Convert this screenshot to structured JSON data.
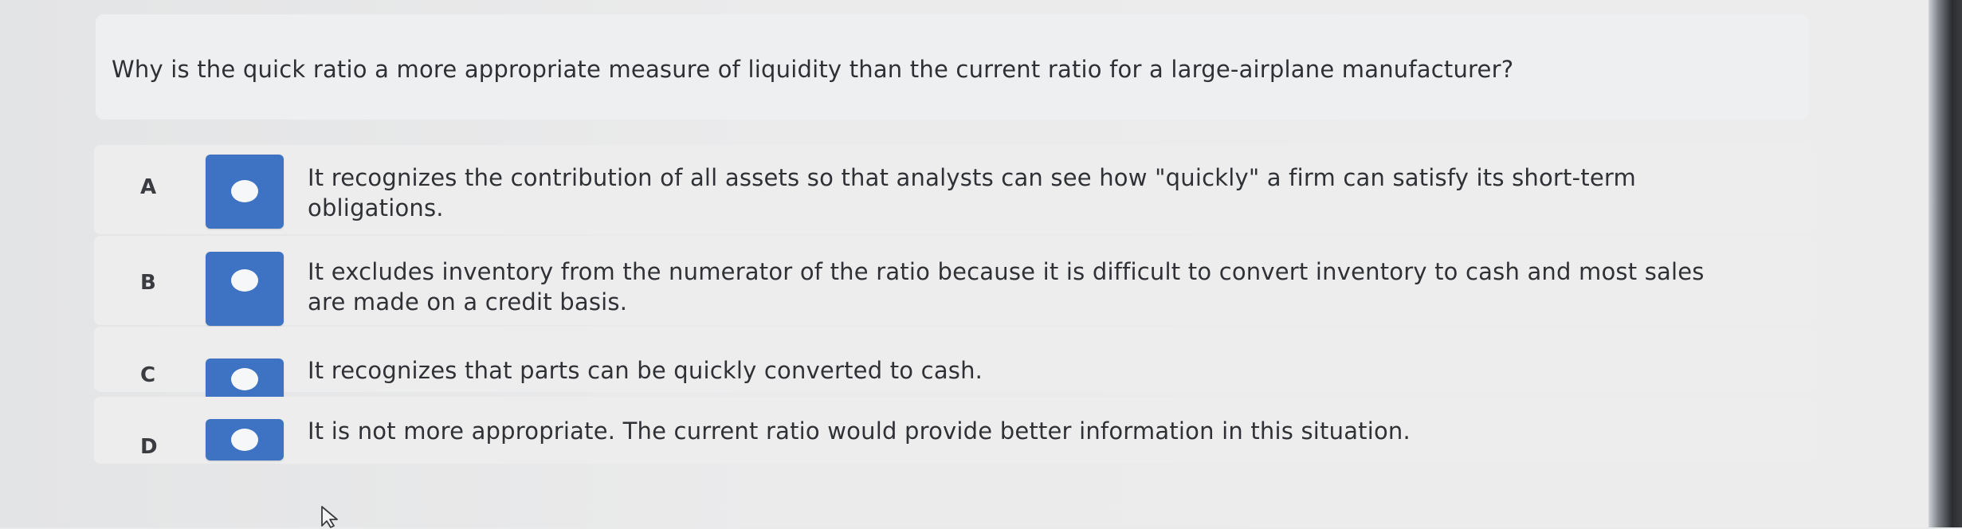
{
  "question": {
    "text": "Why is the quick ratio a more appropriate measure of liquidity than the current ratio for a large-airplane manufacturer?"
  },
  "options": [
    {
      "letter": "A",
      "line1": "It recognizes the contribution of all assets so that analysts can see how \"quickly\" a firm can satisfy its short-term",
      "line2": "obligations."
    },
    {
      "letter": "B",
      "line1": "It excludes inventory from the numerator of the ratio because it is difficult to convert inventory to cash and most sales",
      "line2": "are made on a credit basis."
    },
    {
      "letter": "C",
      "line1": "It recognizes that parts can be quickly converted to cash.",
      "line2": ""
    },
    {
      "letter": "D",
      "line1": "It is not more appropriate. The current ratio would provide better information in this situation.",
      "line2": ""
    }
  ],
  "colors": {
    "radio_accent": "#3d73c2",
    "text": "#2f3135"
  },
  "icons": {
    "radio": "radio-icon",
    "cursor": "mouse-pointer-icon"
  }
}
